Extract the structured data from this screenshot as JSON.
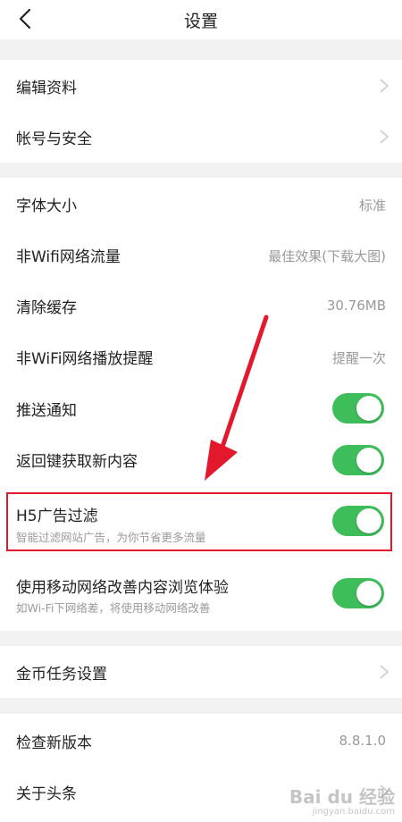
{
  "header": {
    "title": "设置"
  },
  "group1": [
    {
      "label": "编辑资料"
    },
    {
      "label": "帐号与安全"
    }
  ],
  "group2": {
    "font_size": {
      "label": "字体大小",
      "value": "标准"
    },
    "non_wifi_traffic": {
      "label": "非Wifi网络流量",
      "value": "最佳效果(下载大图)"
    },
    "clear_cache": {
      "label": "清除缓存",
      "value": "30.76MB"
    },
    "non_wifi_play": {
      "label": "非WiFi网络播放提醒",
      "value": "提醒一次"
    },
    "push": {
      "label": "推送通知",
      "enabled": true
    },
    "back_refresh": {
      "label": "返回键获取新内容",
      "enabled": true
    },
    "h5_ad": {
      "label": "H5广告过滤",
      "sub": "智能过滤网站广告，为你节省更多流量",
      "enabled": true
    },
    "mobile_improve": {
      "label": "使用移动网络改善内容浏览体验",
      "sub": "如Wi-Fi下网络差，将使用移动网络改善",
      "enabled": true
    }
  },
  "group3": {
    "coin_task": {
      "label": "金币任务设置"
    }
  },
  "group4": {
    "check_update": {
      "label": "检查新版本",
      "value": "8.8.1.0"
    },
    "about": {
      "label": "关于头条"
    }
  },
  "watermark": {
    "main": "Bai du 经验",
    "sub": "jingyan.baidu.com"
  },
  "colors": {
    "toggle_on": "#3ebd5b",
    "highlight": "#e3182d",
    "background": "#f2f2f2"
  }
}
